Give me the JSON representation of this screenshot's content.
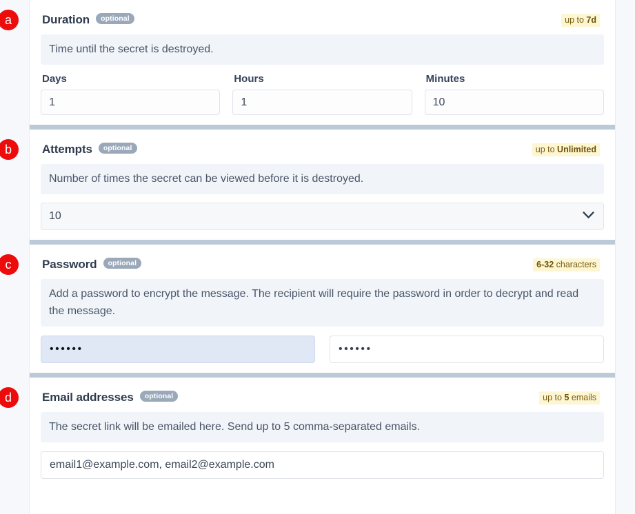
{
  "sections": [
    {
      "key": "duration",
      "letter": "a",
      "title": "Duration",
      "optional_label": "optional",
      "limit_prefix": "up to ",
      "limit_value": "7d",
      "limit_suffix": "",
      "description": "Time until the secret is destroyed.",
      "fields": [
        {
          "label": "Days",
          "value": "1"
        },
        {
          "label": "Hours",
          "value": "1"
        },
        {
          "label": "Minutes",
          "value": "10"
        }
      ]
    },
    {
      "key": "attempts",
      "letter": "b",
      "title": "Attempts",
      "optional_label": "optional",
      "limit_prefix": "up to ",
      "limit_value": "Unlimited",
      "limit_suffix": "",
      "description": "Number of times the secret can be viewed before it is destroyed.",
      "select_value": "10",
      "select_icon": "chevron-down-icon"
    },
    {
      "key": "password",
      "letter": "c",
      "title": "Password",
      "optional_label": "optional",
      "limit_prefix": "",
      "limit_value": "6-32",
      "limit_suffix": " characters",
      "description": "Add a password to encrypt the message. The recipient will require the password in order to decrypt and read the message.",
      "password_value": "••••••",
      "password_confirm_value": "••••••"
    },
    {
      "key": "email",
      "letter": "d",
      "title": "Email addresses",
      "optional_label": "optional",
      "limit_prefix": "up to ",
      "limit_value": "5",
      "limit_suffix": " emails",
      "description": "The secret link will be emailed here. Send up to 5 comma-separated emails.",
      "email_value": "email1@example.com, email2@example.com"
    }
  ],
  "colors": {
    "badge_red": "#ed0c0c",
    "optional_gray": "#9aa8b9",
    "limit_yellow_bg": "#fdf6d3",
    "limit_text": "#7b5c10",
    "divider": "#bcc9d6",
    "description_bg": "#f1f5f9",
    "autofill_blue": "#e0e8f6"
  }
}
